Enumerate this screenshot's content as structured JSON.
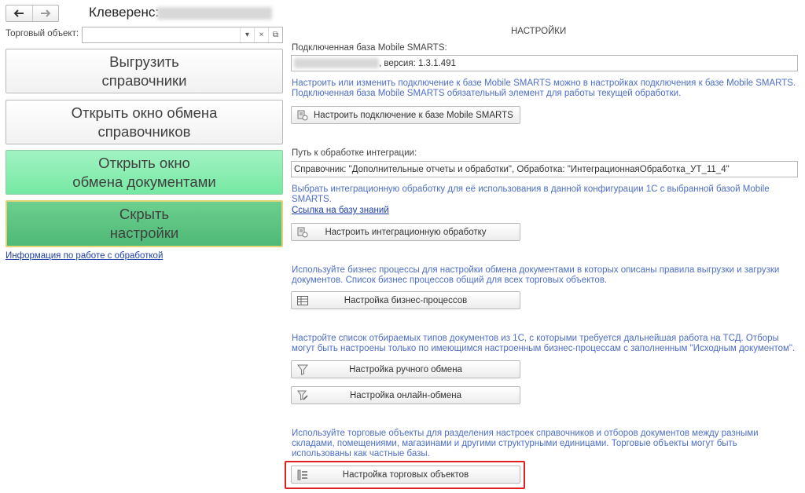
{
  "header": {
    "title": "Клеверенс:"
  },
  "trade_object": {
    "label": "Торговый объект:",
    "value": "",
    "dropdown_icon": "▾",
    "clear_icon": "×",
    "open_icon": "⧉"
  },
  "left_buttons": {
    "export_line1": "Выгрузить",
    "export_line2": "справочники",
    "ref_exchange_line1": "Открыть окно обмена",
    "ref_exchange_line2": "справочников",
    "doc_exchange_line1": "Открыть окно",
    "doc_exchange_line2": "обмена документами",
    "hide_settings_line1": "Скрыть",
    "hide_settings_line2": "настройки"
  },
  "info_link": "Информация по работе с обработкой",
  "settings": {
    "heading": "НАСТРОЙКИ",
    "db_label": "Подключенная база Mobile SMARTS:",
    "db_value_suffix": ", версия: 1.3.1.491",
    "db_hint": "Настроить или изменить подключение к базе Mobile SMARTS можно в настройках подключения к базе Mobile SMARTS. Подключенная база Mobile SMARTS обязательный элемент для работы текущей обработки.",
    "db_button": "Настроить подключение к базе Mobile SMARTS",
    "path_label": "Путь к обработке интеграции:",
    "path_value": "Справочник: \"Дополнительные отчеты и обработки\", Обработка: \"ИнтеграционнаяОбработка_УТ_11_4\"",
    "path_hint": "Выбрать интеграционную обработку для её использования в данной конфигурации 1С с выбранной базой Mobile SMARTS.",
    "kb_link": "Ссылка на базу знаний",
    "integration_button": "Настроить интеграционную обработку",
    "bp_hint": "Используйте бизнес процессы для настройки обмена документами в которых описаны правила выгрузки и загрузки документов. Список бизнес процессов общий для всех торговых объектов.",
    "bp_button": "Настройка бизнес-процессов",
    "doc_types_hint": "Настройте список отбираемых типов документов из 1С, с которыми требуется дальнейшая работа на ТСД. Отборы могут быть настроены только по имеющимся настроенным бизнес-процессам с заполненным \"Исходным документом\".",
    "manual_button": "Настройка ручного обмена",
    "online_button": "Настройка онлайн-обмена",
    "trade_hint": "Используйте торговые объекты для разделения настроек справочников и отборов документов между разными складами, помещениями, магазинами и другими структурными единицами. Торговые объекты могут быть использованы как частные базы.",
    "trade_button": "Настройка торговых объектов"
  },
  "colors": {
    "hint": "#4d6fc9",
    "link": "#1d3fa5",
    "green_button": "#86eeae",
    "dark_green_button": "#5bc382",
    "highlight": "#e02020"
  }
}
